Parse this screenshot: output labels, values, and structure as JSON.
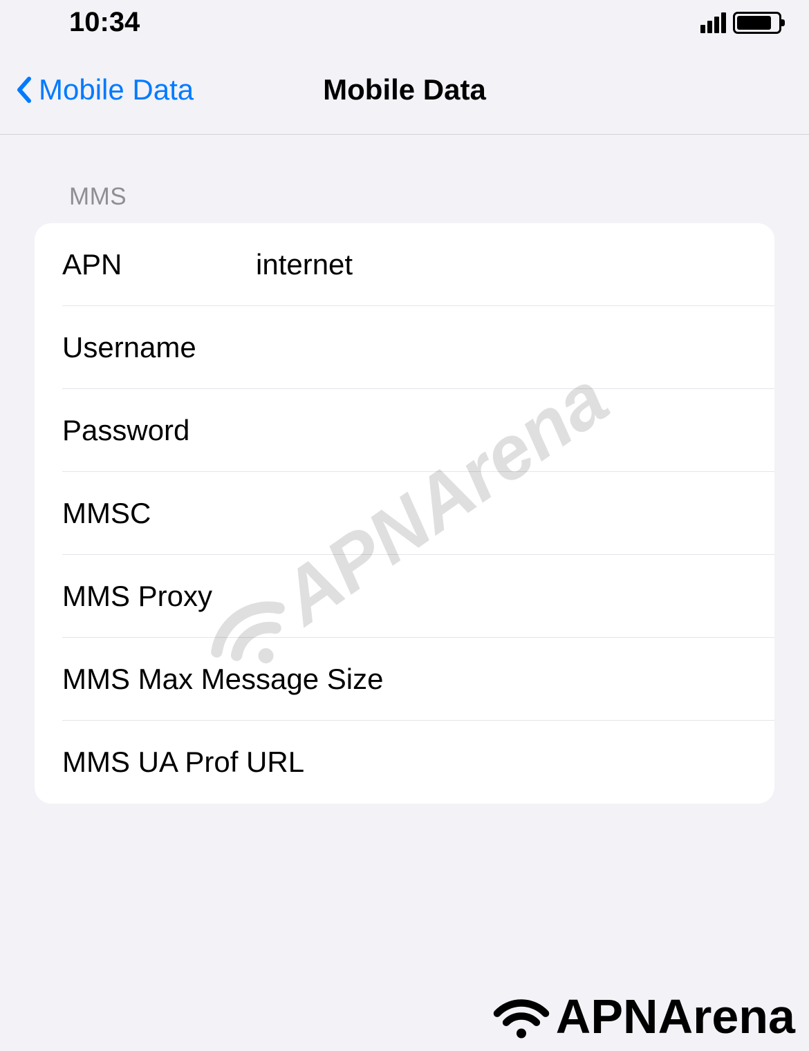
{
  "statusBar": {
    "time": "10:34"
  },
  "nav": {
    "backLabel": "Mobile Data",
    "title": "Mobile Data"
  },
  "section": {
    "header": "MMS",
    "rows": [
      {
        "label": "APN",
        "value": "internet"
      },
      {
        "label": "Username",
        "value": ""
      },
      {
        "label": "Password",
        "value": ""
      },
      {
        "label": "MMSC",
        "value": ""
      },
      {
        "label": "MMS Proxy",
        "value": ""
      },
      {
        "label": "MMS Max Message Size",
        "value": ""
      },
      {
        "label": "MMS UA Prof URL",
        "value": ""
      }
    ]
  },
  "watermark": {
    "text": "APNArena"
  },
  "footerBrand": {
    "text": "APNArena"
  }
}
